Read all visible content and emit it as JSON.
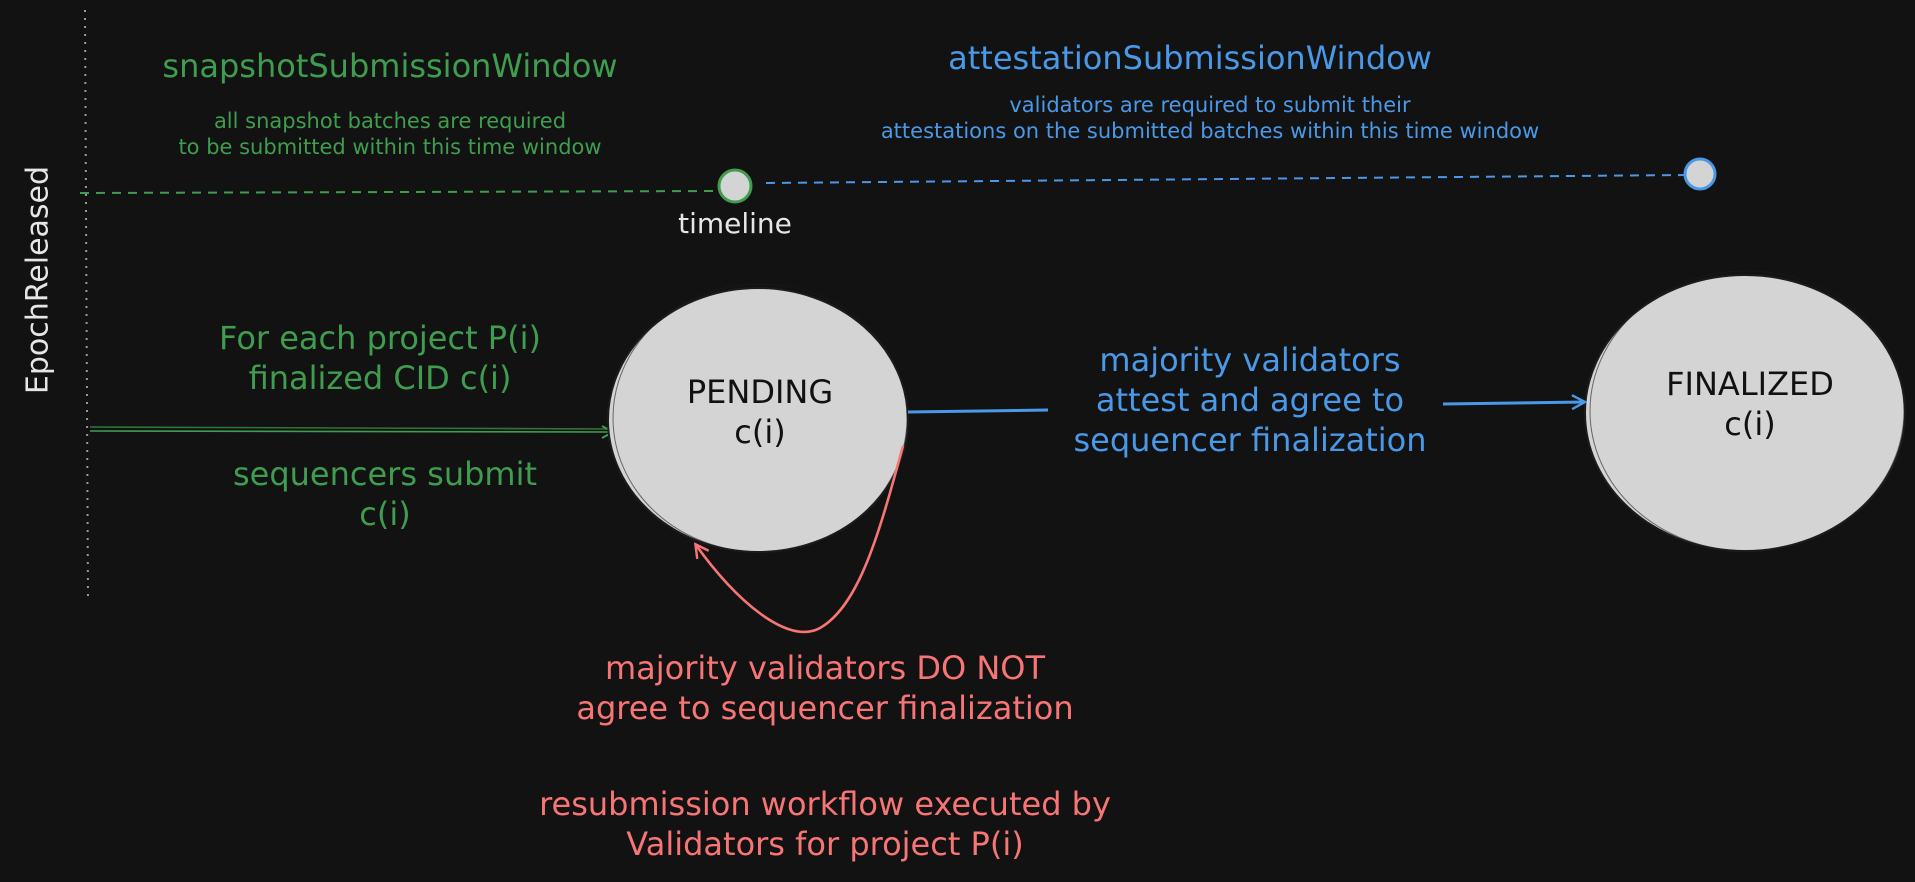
{
  "colors": {
    "background": "#121212",
    "green": "#3f9d4f",
    "blue": "#4a99e8",
    "red": "#f87575",
    "node_fill": "#d4d4d4",
    "node_text": "#111111",
    "muted": "#9a9a9a"
  },
  "snapshot_window": {
    "title": "snapshotSubmissionWindow",
    "description": "all snapshot batches are required\nto be submitted within this time window"
  },
  "attestation_window": {
    "title": "attestationSubmissionWindow",
    "description": "validators are required to submit their\nattestations on the submitted batches within this time window"
  },
  "timeline_label": "timeline",
  "epoch_label": "EpochReleased",
  "project_label": "For each project P(i)\nfinalized CID c(i)",
  "sequencer_label": "sequencers submit\nc(i)",
  "pending_node": "PENDING\nc(i)",
  "finalized_node": "FINALIZED\nc(i)",
  "attest_label": "majority validators\nattest and agree to\nsequencer finalization",
  "reject_label": "majority validators DO NOT\nagree to sequencer finalization",
  "resubmission_label": "resubmission workflow executed by\nValidators for project P(i)"
}
